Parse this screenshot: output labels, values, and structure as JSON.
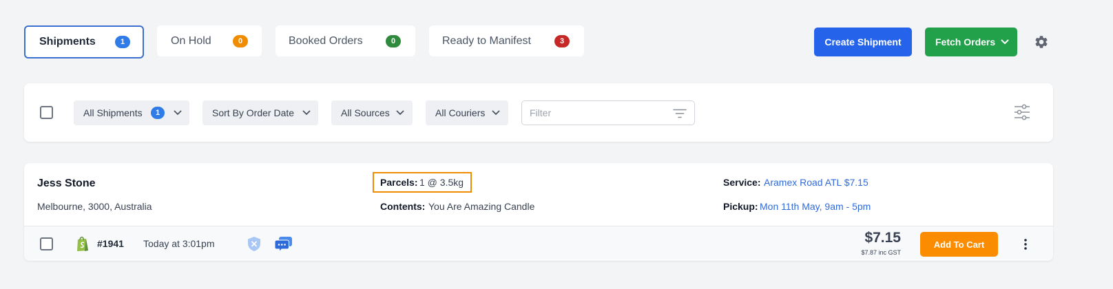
{
  "tabs": [
    {
      "label": "Shipments",
      "count": "1",
      "color": "#2f7be8",
      "active": true
    },
    {
      "label": "On Hold",
      "count": "0",
      "color": "#f08c00",
      "active": false
    },
    {
      "label": "Booked Orders",
      "count": "0",
      "color": "#2f8a3e",
      "active": false
    },
    {
      "label": "Ready to Manifest",
      "count": "3",
      "color": "#c62828",
      "active": false
    }
  ],
  "actions": {
    "create_shipment": "Create Shipment",
    "fetch_orders": "Fetch Orders",
    "settings_icon": "gear-icon"
  },
  "filters": {
    "all_shipments": "All Shipments",
    "all_shipments_count": "1",
    "sort": "Sort By Order Date",
    "sources": "All Sources",
    "couriers": "All Couriers",
    "filter_placeholder": "Filter"
  },
  "shipment": {
    "name": "Jess Stone",
    "address": "Melbourne, 3000, Australia",
    "parcels_label": "Parcels:",
    "parcels_value": "1 @ 3.5kg",
    "contents_label": "Contents:",
    "contents_value": "You Are Amazing Candle",
    "service_label": "Service:",
    "service_value": "Aramex Road ATL $7.15",
    "pickup_label": "Pickup:",
    "pickup_value": "Mon 11th May, 9am - 5pm",
    "order_number": "#1941",
    "order_time": "Today at 3:01pm",
    "price": "$7.15",
    "price_inc": "$7.87 inc GST",
    "add_to_cart": "Add To Cart"
  },
  "colors": {
    "primary_blue": "#2563eb",
    "green": "#22a04a",
    "orange": "#fb8c00",
    "highlight_box": "#f08c00"
  }
}
